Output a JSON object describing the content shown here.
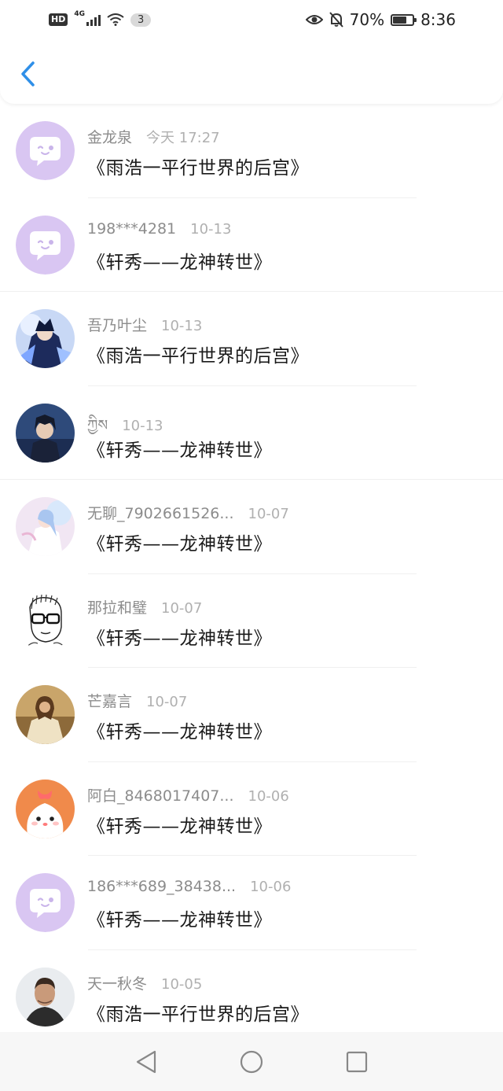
{
  "status_bar": {
    "hd": "HD",
    "network": "4G",
    "wifi_count": "3",
    "battery": "70%",
    "battery_fraction": 0.7,
    "time": "8:36"
  },
  "header": {
    "back_icon": "chevron-left-icon",
    "accent": "#2f8fe8"
  },
  "messages": [
    {
      "name": "金龙泉",
      "time": "今天 17:27",
      "book": "《雨浩一平行世界的后宫》",
      "avatar": "default-chat"
    },
    {
      "name": "198***4281",
      "time": "10-13",
      "book": "《轩秀——龙神转世》",
      "avatar": "default-chat"
    },
    {
      "name": "吾乃叶尘",
      "time": "10-13",
      "book": "《雨浩一平行世界的后宫》",
      "avatar": "anime-blue"
    },
    {
      "name": "ཀྱིས",
      "time": "10-13",
      "book": "《轩秀——龙神转世》",
      "avatar": "anime-dark"
    },
    {
      "name": "无聊_7902661526...",
      "time": "10-07",
      "book": "《轩秀——龙神转世》",
      "avatar": "anime-pastel"
    },
    {
      "name": "那拉和璧",
      "time": "10-07",
      "book": "《轩秀——龙神转世》",
      "avatar": "sketch-glasses"
    },
    {
      "name": "芒嘉言",
      "time": "10-07",
      "book": "《轩秀——龙神转世》",
      "avatar": "painting"
    },
    {
      "name": "阿白_8468017407...",
      "time": "10-06",
      "book": "《轩秀——龙神转世》",
      "avatar": "cute-bunny"
    },
    {
      "name": "186***689_38438...",
      "time": "10-06",
      "book": "《轩秀——龙神转世》",
      "avatar": "default-chat"
    },
    {
      "name": "天一秋冬",
      "time": "10-05",
      "book": "《雨浩一平行世界的后宫》",
      "avatar": "photo-man"
    }
  ],
  "nav": {
    "back": "triangle-back-icon",
    "home": "circle-home-icon",
    "recents": "square-recents-icon"
  }
}
